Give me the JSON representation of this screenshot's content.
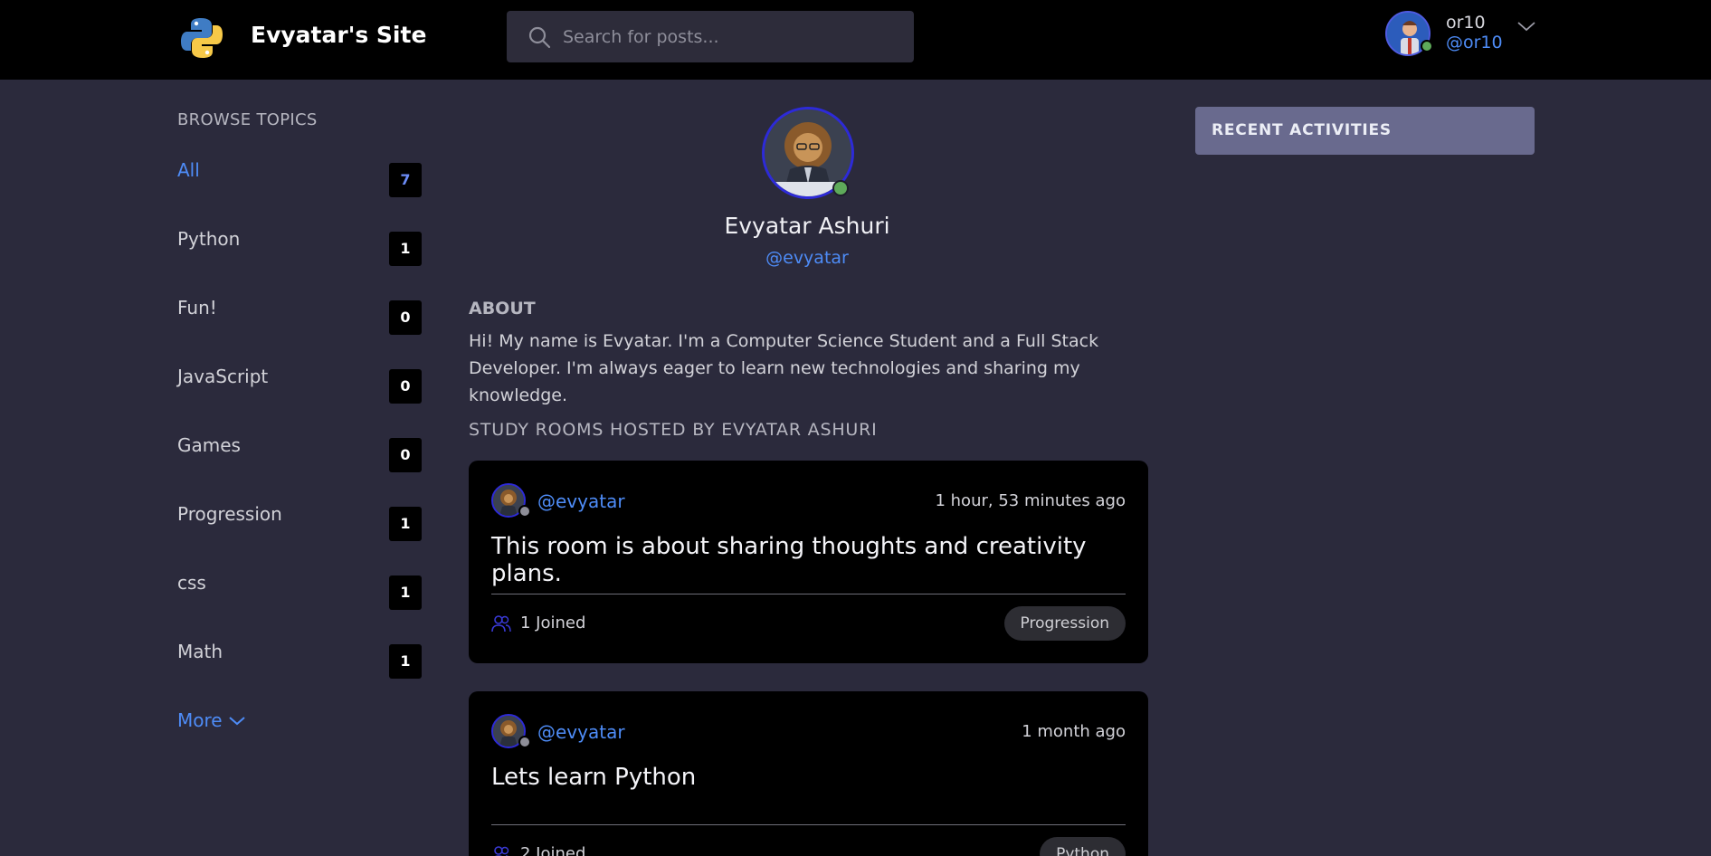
{
  "header": {
    "site_title": "Evyatar's Site",
    "search_placeholder": "Search for posts...",
    "user": {
      "name": "or10",
      "handle": "@or10"
    }
  },
  "sidebar": {
    "title": "BROWSE TOPICS",
    "topics": [
      {
        "label": "All",
        "count": "7",
        "active": true
      },
      {
        "label": "Python",
        "count": "1"
      },
      {
        "label": "Fun!",
        "count": "0"
      },
      {
        "label": "JavaScript",
        "count": "0"
      },
      {
        "label": "Games",
        "count": "0"
      },
      {
        "label": "Progression",
        "count": "1"
      },
      {
        "label": "css",
        "count": "1"
      },
      {
        "label": "Math",
        "count": "1"
      }
    ],
    "more_label": "More"
  },
  "profile": {
    "name": "Evyatar Ashuri",
    "handle": "@evyatar",
    "about_title": "ABOUT",
    "about_text": "Hi! My name is Evyatar. I'm a Computer Science Student and a Full Stack Developer. I'm always eager to learn new technologies and sharing my knowledge.",
    "rooms_title": "STUDY ROOMS HOSTED BY EVYATAR ASHURI"
  },
  "rooms": [
    {
      "host": "@evyatar",
      "time": "1 hour, 53 minutes ago",
      "title": "This room is about sharing thoughts and creativity plans.",
      "joined": "1 Joined",
      "topic": "Progression"
    },
    {
      "host": "@evyatar",
      "time": "1 month ago",
      "title": "Lets learn Python",
      "joined": "2 Joined",
      "topic": "Python"
    }
  ],
  "activity": {
    "title": "RECENT ACTIVITIES"
  },
  "colors": {
    "background": "#2b2a3c",
    "header": "#000000",
    "accent": "#4e8cf7",
    "card": "#000000",
    "activities_bar": "#696a8e",
    "online": "#5eaa5a"
  },
  "icons": [
    "python-logo-icon",
    "search-icon",
    "chevron-down-icon",
    "people-icon",
    "avatar"
  ]
}
